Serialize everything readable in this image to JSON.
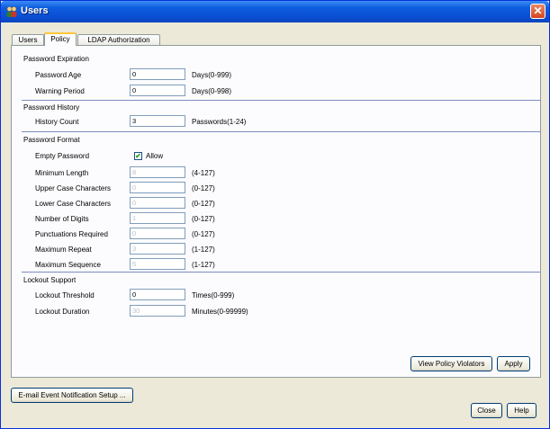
{
  "window": {
    "title": "Users",
    "close_glyph": "✕"
  },
  "tabs": [
    {
      "label": "Users"
    },
    {
      "label": "Policy"
    },
    {
      "label": "LDAP Authorization"
    }
  ],
  "password_expiration": {
    "title": "Password Expiration",
    "age_label": "Password Age",
    "age_value": "0",
    "age_unit": "Days(0-999)",
    "warning_label": "Warning Period",
    "warning_value": "0",
    "warning_unit": "Days(0-998)"
  },
  "password_history": {
    "title": "Password History",
    "count_label": "History Count",
    "count_value": "3",
    "count_unit": "Passwords(1-24)"
  },
  "password_format": {
    "title": "Password Format",
    "empty_label": "Empty Password",
    "allow_label": "Allow",
    "allow_checked": true,
    "check_glyph": "✔",
    "rows": [
      {
        "label": "Minimum Length",
        "value": "8",
        "range": "(4-127)"
      },
      {
        "label": "Upper Case Characters",
        "value": "0",
        "range": "(0-127)"
      },
      {
        "label": "Lower Case Characters",
        "value": "0",
        "range": "(0-127)"
      },
      {
        "label": "Number of Digits",
        "value": "1",
        "range": "(0-127)"
      },
      {
        "label": "Punctuations Required",
        "value": "0",
        "range": "(0-127)"
      },
      {
        "label": "Maximum Repeat",
        "value": "3",
        "range": "(1-127)"
      },
      {
        "label": "Maximum Sequence",
        "value": "5",
        "range": "(1-127)"
      }
    ]
  },
  "lockout": {
    "title": "Lockout Support",
    "threshold_label": "Lockout Threshold",
    "threshold_value": "0",
    "threshold_unit": "Times(0-999)",
    "duration_label": "Lockout Duration",
    "duration_value": "30",
    "duration_unit": "Minutes(0-99999)"
  },
  "buttons": {
    "view_violators": "View Policy Violators",
    "apply": "Apply",
    "email_setup": "E-mail Event Notification Setup ...",
    "close": "Close",
    "help": "Help"
  }
}
